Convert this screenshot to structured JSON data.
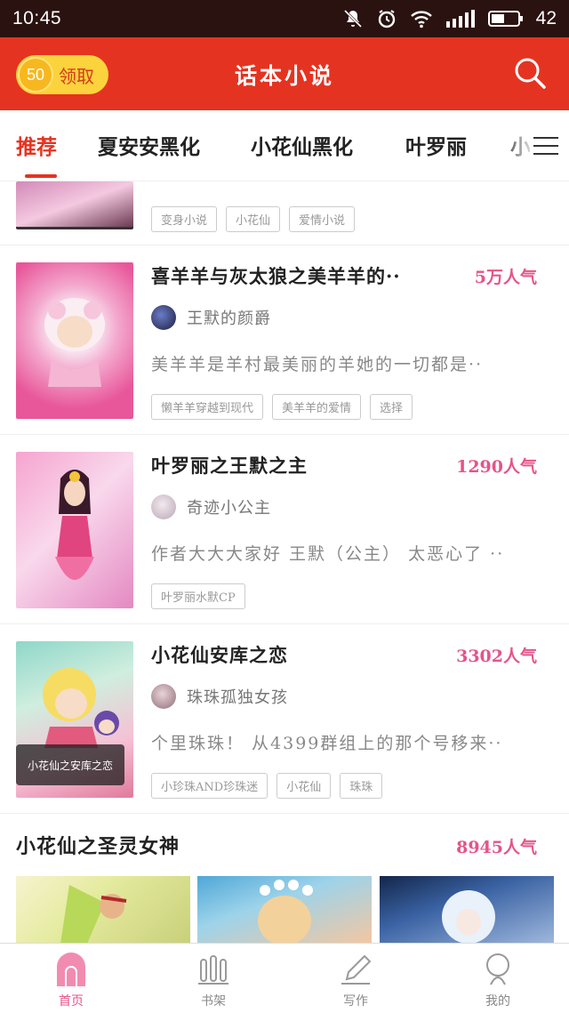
{
  "status_bar": {
    "time": "10:45",
    "battery": "42"
  },
  "header": {
    "coin_count": "50",
    "coin_label": "领取",
    "title": "话本小说"
  },
  "tabs": [
    {
      "label": "推荐"
    },
    {
      "label": "夏安安黑化"
    },
    {
      "label": "小花仙黑化"
    },
    {
      "label": "叶罗丽"
    },
    {
      "label": "小"
    }
  ],
  "partial_item": {
    "tags": [
      "变身小说",
      "小花仙",
      "爱情小说"
    ]
  },
  "books": [
    {
      "title": "喜羊羊与灰太狼之美羊羊的··",
      "popularity": "5万人气",
      "author": "王默的颜爵",
      "summary": "美羊羊是羊村最美丽的羊她的一切都是··",
      "tags": [
        "懒羊羊穿越到现代",
        "美羊羊的爱情",
        "选择"
      ]
    },
    {
      "title": "叶罗丽之王默之主",
      "popularity": "1290人气",
      "author": "奇迹小公主",
      "summary": "作者大大大家好 王默（公主） 太恶心了 ··",
      "tags": [
        "叶罗丽水默CP"
      ]
    },
    {
      "title": "小花仙安库之恋",
      "popularity": "3302人气",
      "author": "珠珠孤独女孩",
      "summary": "个里珠珠！ 从4399群组上的那个号移来··",
      "thumb_caption": "小花仙之安库之恋",
      "tags": [
        "小珍珠AND珍珠迷",
        "小花仙",
        "珠珠"
      ]
    }
  ],
  "section": {
    "title": "小花仙之圣灵女神",
    "popularity": "8945人气"
  },
  "bottom_nav": [
    {
      "label": "首页",
      "icon": "home-icon"
    },
    {
      "label": "书架",
      "icon": "bookshelf-icon"
    },
    {
      "label": "写作",
      "icon": "pencil-icon"
    },
    {
      "label": "我的",
      "icon": "profile-icon"
    }
  ],
  "colors": {
    "brand_red": "#e53321",
    "popularity_pink": "#e5548a",
    "coin_yellow": "#fbd33c"
  }
}
